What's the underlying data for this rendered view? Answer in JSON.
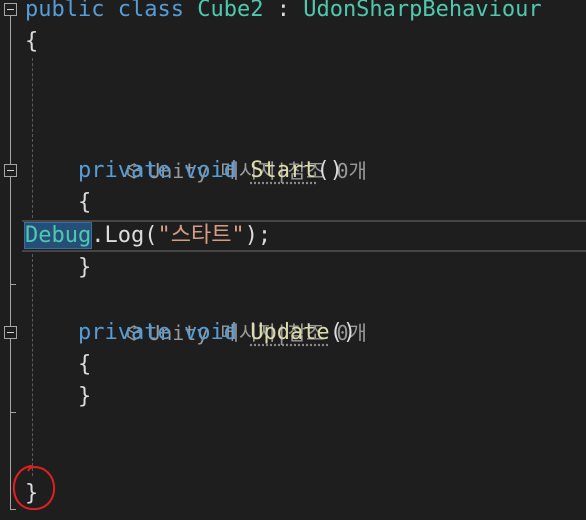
{
  "editor": {
    "class_decl": {
      "keyword_public": "public",
      "keyword_class": "class",
      "class_name": "Cube2",
      "colon": ":",
      "base_class": "UdonSharpBehaviour"
    },
    "open_brace": "{",
    "close_brace": "}",
    "lens_text": "Unity 메시지|참조 0개",
    "start_method": {
      "modifier": "private",
      "return_type": "void",
      "name": "Start",
      "parens": "()"
    },
    "start_body": {
      "open": "{",
      "close": "}",
      "stmt_type": "Debug",
      "stmt_rest": ".Log(",
      "stmt_string": "\"스타트\"",
      "stmt_end": ");"
    },
    "update_method": {
      "modifier": "private",
      "return_type": "void",
      "name": "Update",
      "parens": "()"
    },
    "update_body": {
      "open": "{",
      "close": "}"
    }
  },
  "icons": {
    "fold": "collapse-minus-icon",
    "lens": "unity-cube-icon"
  },
  "colors": {
    "background": "#1e1e1e",
    "keyword": "#569cd6",
    "type": "#4ec9b0",
    "string": "#d69d85",
    "text": "#dcdcdc",
    "lens": "#999999",
    "annotation": "#e02020"
  }
}
